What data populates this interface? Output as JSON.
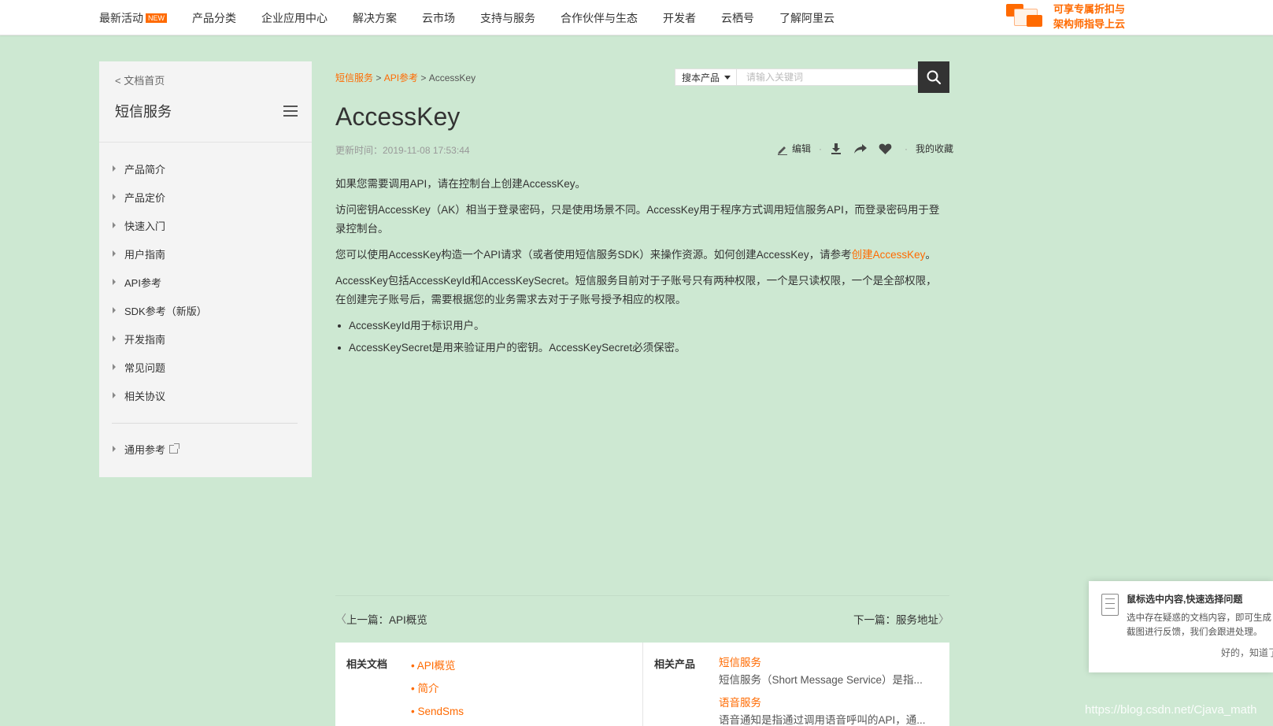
{
  "nav": {
    "items": [
      {
        "label": "最新活动",
        "badge": "NEW"
      },
      {
        "label": "产品分类"
      },
      {
        "label": "企业应用中心"
      },
      {
        "label": "解决方案"
      },
      {
        "label": "云市场"
      },
      {
        "label": "支持与服务"
      },
      {
        "label": "合作伙伴与生态"
      },
      {
        "label": "开发者"
      },
      {
        "label": "云栖号"
      },
      {
        "label": "了解阿里云"
      }
    ],
    "promo_line1": "可享专属折扣与",
    "promo_line2": "架构师指导上云"
  },
  "sidebar": {
    "back": "< 文档首页",
    "title": "短信服务",
    "items": [
      "产品简介",
      "产品定价",
      "快速入门",
      "用户指南",
      "API参考",
      "SDK参考（新版）",
      "开发指南",
      "常见问题",
      "相关协议"
    ],
    "extra": "通用参考"
  },
  "breadcrumb": {
    "item1": "短信服务",
    "sep": " > ",
    "item2": "API参考",
    "current": "AccessKey"
  },
  "search": {
    "scope": "搜本产品",
    "placeholder": "请输入关键词"
  },
  "article": {
    "title": "AccessKey",
    "updated": "更新时间：2019-11-08 17:53:44",
    "actions": {
      "edit": "编辑",
      "favorites": "我的收藏"
    },
    "p1": "如果您需要调用API，请在控制台上创建AccessKey。",
    "p2": "访问密钥AccessKey（AK）相当于登录密码，只是使用场景不同。AccessKey用于程序方式调用短信服务API，而登录密码用于登录控制台。",
    "p3_before": "您可以使用AccessKey构造一个API请求（或者使用短信服务SDK）来操作资源。如何创建AccessKey，请参考",
    "p3_link": "创建AccessKey",
    "p3_after": "。",
    "p4": "AccessKey包括AccessKeyId和AccessKeySecret。短信服务目前对于子账号只有两种权限，一个是只读权限，一个是全部权限，在创建完子账号后，需要根据您的业务需求去对于子账号授予相应的权限。",
    "bullets": [
      "AccessKeyId用于标识用户。",
      "AccessKeySecret是用来验证用户的密钥。AccessKeySecret必须保密。"
    ]
  },
  "pager": {
    "prev": "上一篇：API概览",
    "next": "下一篇：服务地址"
  },
  "related": {
    "docs_header": "相关文档",
    "docs": [
      "• API概览",
      "• 简介",
      "• SendSms"
    ],
    "prods_header": "相关产品",
    "prods": [
      {
        "name": "短信服务",
        "desc": "短信服务（Short Message Service）是指..."
      },
      {
        "name": "语音服务",
        "desc": "语音通知是指通过调用语音呼叫的API，通..."
      }
    ]
  },
  "feedback": {
    "title": "鼠标选中内容,快速选择问题",
    "line1": "选中存在疑惑的文档内容，即可生成",
    "line2": "截图进行反馈，我们会跟进处理。",
    "ok": "好的，知道了"
  },
  "watermark": "https://blog.csdn.net/Cjava_math",
  "colors": {
    "accent": "#ff6a00",
    "background": "#cde8d2",
    "search_button": "#333333"
  }
}
